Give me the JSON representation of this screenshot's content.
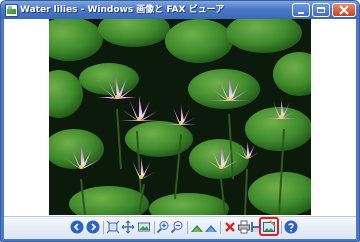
{
  "window": {
    "title": "Water lilies - Windows 画像と FAX ビューア"
  },
  "image": {
    "description_name": "water-lilies-photo"
  },
  "toolbar": {
    "buttons": [
      {
        "name": "previous-image-button",
        "icon": "arrow-left-icon"
      },
      {
        "name": "next-image-button",
        "icon": "arrow-right-icon"
      },
      {
        "name": "best-fit-button",
        "icon": "fit-to-window-icon"
      },
      {
        "name": "actual-size-button",
        "icon": "actual-size-icon"
      },
      {
        "name": "slideshow-button",
        "icon": "slideshow-icon"
      },
      {
        "name": "zoom-in-button",
        "icon": "zoom-in-icon"
      },
      {
        "name": "zoom-out-button",
        "icon": "zoom-out-icon"
      },
      {
        "name": "rotate-clockwise-button",
        "icon": "rotate-clockwise-icon"
      },
      {
        "name": "rotate-counterclockwise-button",
        "icon": "rotate-counterclockwise-icon"
      },
      {
        "name": "delete-button",
        "icon": "delete-x-icon"
      },
      {
        "name": "print-button",
        "icon": "printer-icon"
      },
      {
        "name": "copy-to-button",
        "icon": "floppy-icon"
      },
      {
        "name": "edit-button",
        "icon": "edit-image-icon"
      },
      {
        "name": "help-button",
        "icon": "help-icon"
      }
    ],
    "highlight_color": "#d9221b"
  },
  "colors": {
    "titlebar": "#4b79c6",
    "toolbar": "#dbe5f4"
  }
}
